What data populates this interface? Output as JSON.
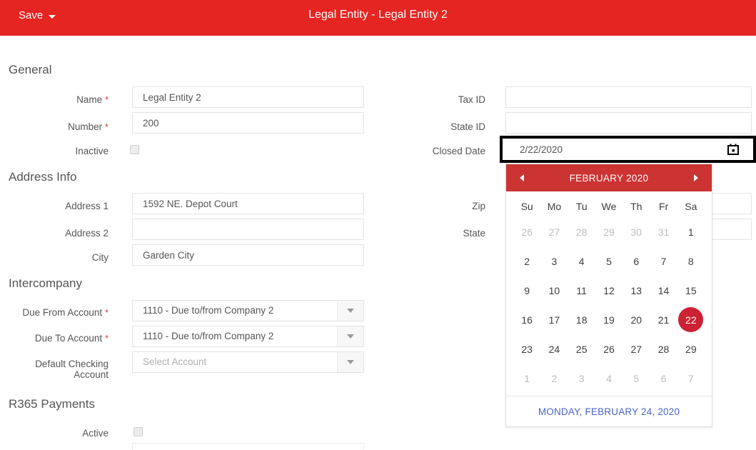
{
  "topbar": {
    "save_label": "Save",
    "title": "Legal Entity - Legal Entity 2",
    "background_color": "#e52521"
  },
  "sections": {
    "general": "General",
    "address_info": "Address Info",
    "intercompany": "Intercompany",
    "r365_payments": "R365 Payments"
  },
  "fields": {
    "name": {
      "label": "Name",
      "required": "*",
      "value": "Legal Entity 2"
    },
    "number": {
      "label": "Number",
      "required": "*",
      "value": "200"
    },
    "inactive": {
      "label": "Inactive",
      "checked": false
    },
    "address1": {
      "label": "Address 1",
      "value": "1592 NE. Depot Court"
    },
    "address2": {
      "label": "Address 2",
      "value": ""
    },
    "city": {
      "label": "City",
      "value": "Garden City"
    },
    "due_from_account": {
      "label": "Due From Account",
      "required": "*",
      "value": "1110 - Due to/from Company 2"
    },
    "due_to_account": {
      "label": "Due To Account",
      "required": "*",
      "value": "1110 - Due to/from Company 2"
    },
    "default_checking_account": {
      "label_line1": "Default Checking",
      "label_line2": "Account",
      "placeholder": "Select Account"
    },
    "active": {
      "label": "Active",
      "checked": false
    },
    "tax_id": {
      "label": "Tax ID",
      "value": ""
    },
    "state_id": {
      "label": "State ID",
      "value": ""
    },
    "closed_date": {
      "label": "Closed Date",
      "value": "2/22/2020",
      "icon": "calendar-icon"
    },
    "zip": {
      "label": "Zip",
      "value": ""
    },
    "state": {
      "label": "State",
      "value": ""
    }
  },
  "datepicker": {
    "month_title": "FEBRUARY 2020",
    "prev_icon": "chevron-left-icon",
    "next_icon": "chevron-right-icon",
    "header_color": "#cc3333",
    "selected_color": "#cc2233",
    "footer_text": "MONDAY, FEBRUARY 24, 2020",
    "footer_color": "#4a63c8",
    "day_headers": [
      "Su",
      "Mo",
      "Tu",
      "We",
      "Th",
      "Fr",
      "Sa"
    ],
    "weeks": [
      [
        {
          "d": "26",
          "out": true
        },
        {
          "d": "27",
          "out": true
        },
        {
          "d": "28",
          "out": true
        },
        {
          "d": "29",
          "out": true
        },
        {
          "d": "30",
          "out": true
        },
        {
          "d": "31",
          "out": true
        },
        {
          "d": "1",
          "out": false
        }
      ],
      [
        {
          "d": "2",
          "out": false
        },
        {
          "d": "3",
          "out": false
        },
        {
          "d": "4",
          "out": false
        },
        {
          "d": "5",
          "out": false
        },
        {
          "d": "6",
          "out": false
        },
        {
          "d": "7",
          "out": false
        },
        {
          "d": "8",
          "out": false
        }
      ],
      [
        {
          "d": "9",
          "out": false
        },
        {
          "d": "10",
          "out": false
        },
        {
          "d": "11",
          "out": false
        },
        {
          "d": "12",
          "out": false
        },
        {
          "d": "13",
          "out": false
        },
        {
          "d": "14",
          "out": false
        },
        {
          "d": "15",
          "out": false
        }
      ],
      [
        {
          "d": "16",
          "out": false
        },
        {
          "d": "17",
          "out": false
        },
        {
          "d": "18",
          "out": false
        },
        {
          "d": "19",
          "out": false
        },
        {
          "d": "20",
          "out": false
        },
        {
          "d": "21",
          "out": false
        },
        {
          "d": "22",
          "out": false,
          "selected": true
        }
      ],
      [
        {
          "d": "23",
          "out": false
        },
        {
          "d": "24",
          "out": false
        },
        {
          "d": "25",
          "out": false
        },
        {
          "d": "26",
          "out": false
        },
        {
          "d": "27",
          "out": false
        },
        {
          "d": "28",
          "out": false
        },
        {
          "d": "29",
          "out": false
        }
      ],
      [
        {
          "d": "1",
          "out": true
        },
        {
          "d": "2",
          "out": true
        },
        {
          "d": "3",
          "out": true
        },
        {
          "d": "4",
          "out": true
        },
        {
          "d": "5",
          "out": true
        },
        {
          "d": "6",
          "out": true
        },
        {
          "d": "7",
          "out": true
        }
      ]
    ]
  }
}
